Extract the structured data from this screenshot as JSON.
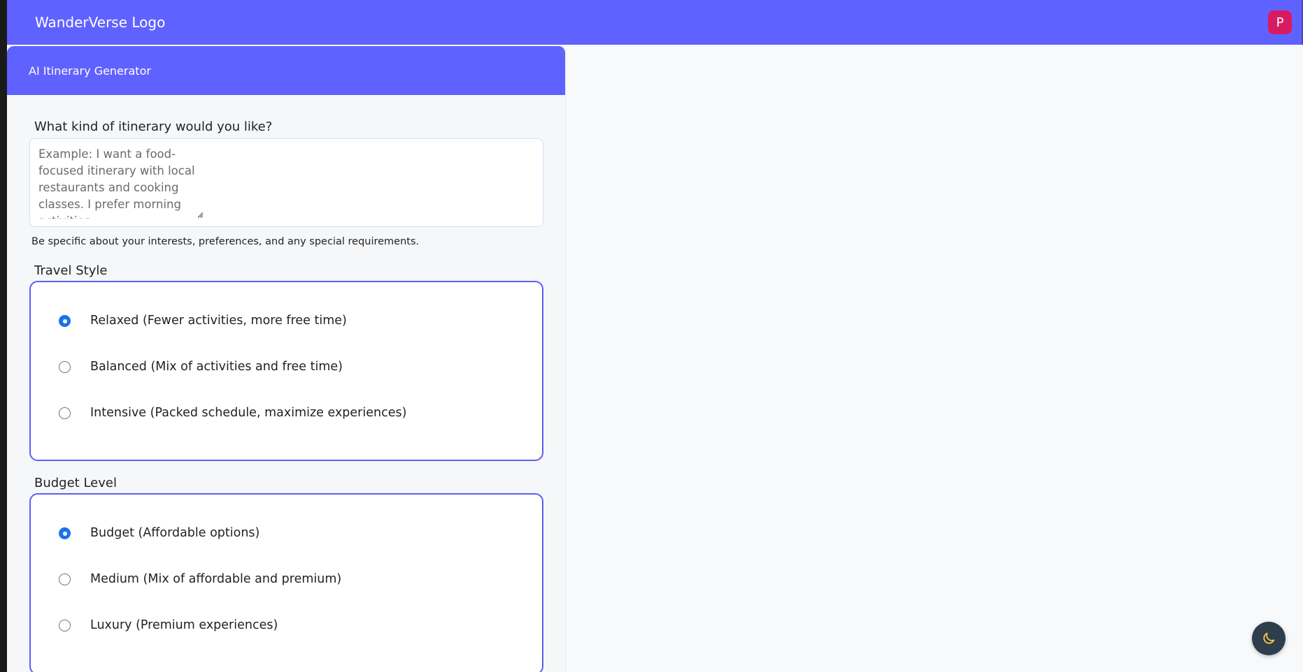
{
  "app": {
    "logo_text": "WanderVerse Logo",
    "avatar_initial": "P",
    "colors": {
      "primary": "#6062ff",
      "avatar": "#d81b60",
      "radio": "#1a73e8",
      "toggle": "#2f3e4d"
    }
  },
  "panel": {
    "title": "AI Itinerary Generator",
    "prompt": {
      "label": "What kind of itinerary would you like?",
      "value": "",
      "placeholder": "Example: I want a food-focused itinerary with local restaurants and cooking classes. I prefer morning activities",
      "hint": "Be specific about your interests, preferences, and any special requirements."
    },
    "travel_style": {
      "label": "Travel Style",
      "selected": "relaxed",
      "options": [
        {
          "id": "relaxed",
          "label": "Relaxed (Fewer activities, more free time)",
          "checked": true
        },
        {
          "id": "balanced",
          "label": "Balanced (Mix of activities and free time)",
          "checked": false
        },
        {
          "id": "intensive",
          "label": "Intensive (Packed schedule, maximize experiences)",
          "checked": false
        }
      ]
    },
    "budget_level": {
      "label": "Budget Level",
      "selected": "budget",
      "options": [
        {
          "id": "budget",
          "label": "Budget (Affordable options)",
          "checked": true
        },
        {
          "id": "medium",
          "label": "Medium (Mix of affordable and premium)",
          "checked": false
        },
        {
          "id": "luxury",
          "label": "Luxury (Premium experiences)",
          "checked": false
        }
      ]
    }
  },
  "icons": {
    "theme_toggle": "moon-icon",
    "textarea_resize": "resize-grip-icon"
  }
}
